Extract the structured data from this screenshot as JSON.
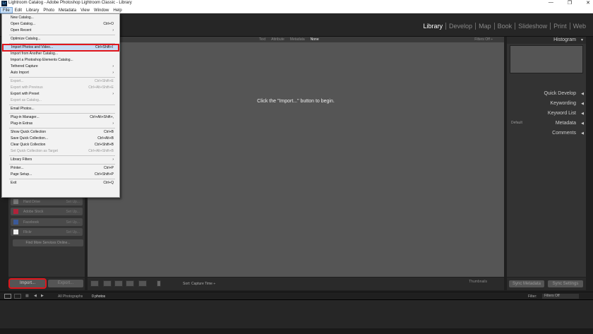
{
  "window": {
    "title": "Lightroom Catalog - Adobe Photoshop Lightroom Classic - Library",
    "app_icon": "Lr",
    "controls": [
      "—",
      "❐",
      "✕"
    ]
  },
  "menubar": [
    "File",
    "Edit",
    "Library",
    "Photo",
    "Metadata",
    "View",
    "Window",
    "Help"
  ],
  "modules": [
    "Library",
    "Develop",
    "Map",
    "Book",
    "Slideshow",
    "Print",
    "Web"
  ],
  "filter_bar": {
    "items": [
      "Text",
      "Attribute",
      "Metadata",
      "None"
    ],
    "filters_off": "Filters Off ÷"
  },
  "center": {
    "hint": "Click the \"Import...\" button to begin."
  },
  "left_panel": {
    "publish": [
      {
        "label": "Hard Drive",
        "setup": "Set Up..."
      },
      {
        "label": "Adobe Stock",
        "setup": "Set Up..."
      },
      {
        "label": "Facebook",
        "setup": "Set Up..."
      },
      {
        "label": "Flickr",
        "setup": "Set Up..."
      }
    ],
    "find_more": "Find More Services Online...",
    "import": "Import...",
    "export": "Export..."
  },
  "toolbar": {
    "sort_label": "Sort:",
    "sort_value": "Capture Time ÷",
    "thumbnails": "Thumbnails"
  },
  "right_panel": {
    "histogram": "Histogram",
    "quick_develop": "Quick Develop",
    "keywording": "Keywording",
    "keyword_list": "Keyword List",
    "metadata": "Metadata",
    "metadata_preset": "Default",
    "comments": "Comments",
    "sync_metadata": "Sync Metadata",
    "sync_settings": "Sync Settings"
  },
  "filmbar": {
    "source": "All Photographs",
    "count": "0 photos",
    "filter_label": "Filter:",
    "filter_value": "Filters Off"
  },
  "file_menu": [
    {
      "label": "New Catalog...",
      "shortcut": ""
    },
    {
      "label": "Open Catalog...",
      "shortcut": "Ctrl+O"
    },
    {
      "label": "Open Recent",
      "shortcut": "›"
    },
    {
      "sep": true
    },
    {
      "label": "Optimize Catalog...",
      "shortcut": ""
    },
    {
      "sep": true
    },
    {
      "label": "Import Photos and Video...",
      "shortcut": "Ctrl+Shift+I",
      "highlight": true
    },
    {
      "label": "Import from Another Catalog...",
      "shortcut": ""
    },
    {
      "label": "Import a Photoshop Elements Catalog...",
      "shortcut": ""
    },
    {
      "label": "Tethered Capture",
      "shortcut": "›"
    },
    {
      "label": "Auto Import",
      "shortcut": "›"
    },
    {
      "sep": true
    },
    {
      "label": "Export...",
      "shortcut": "Ctrl+Shift+E",
      "disabled": true
    },
    {
      "label": "Export with Previous",
      "shortcut": "Ctrl+Alt+Shift+E",
      "disabled": true
    },
    {
      "label": "Export with Preset",
      "shortcut": "›"
    },
    {
      "label": "Export as Catalog...",
      "shortcut": "",
      "disabled": true
    },
    {
      "sep": true
    },
    {
      "label": "Email Photos...",
      "shortcut": ""
    },
    {
      "sep": true
    },
    {
      "label": "Plug-in Manager...",
      "shortcut": "Ctrl+Alt+Shift+,"
    },
    {
      "label": "Plug-in Extras",
      "shortcut": "›"
    },
    {
      "sep": true
    },
    {
      "label": "Show Quick Collection",
      "shortcut": "Ctrl+B"
    },
    {
      "label": "Save Quick Collection...",
      "shortcut": "Ctrl+Alt+B"
    },
    {
      "label": "Clear Quick Collection",
      "shortcut": "Ctrl+Shift+B"
    },
    {
      "label": "Set Quick Collection as Target",
      "shortcut": "Ctrl+Alt+Shift+B",
      "disabled": true
    },
    {
      "sep": true
    },
    {
      "label": "Library Filters",
      "shortcut": "›"
    },
    {
      "sep": true
    },
    {
      "label": "Printer...",
      "shortcut": "Ctrl+P"
    },
    {
      "label": "Page Setup...",
      "shortcut": "Ctrl+Shift+P"
    },
    {
      "sep": true
    },
    {
      "label": "Exit",
      "shortcut": "Ctrl+Q"
    }
  ],
  "colors": {
    "highlight_outline": "#e0161c",
    "menu_highlight": "#c7dcf3"
  }
}
